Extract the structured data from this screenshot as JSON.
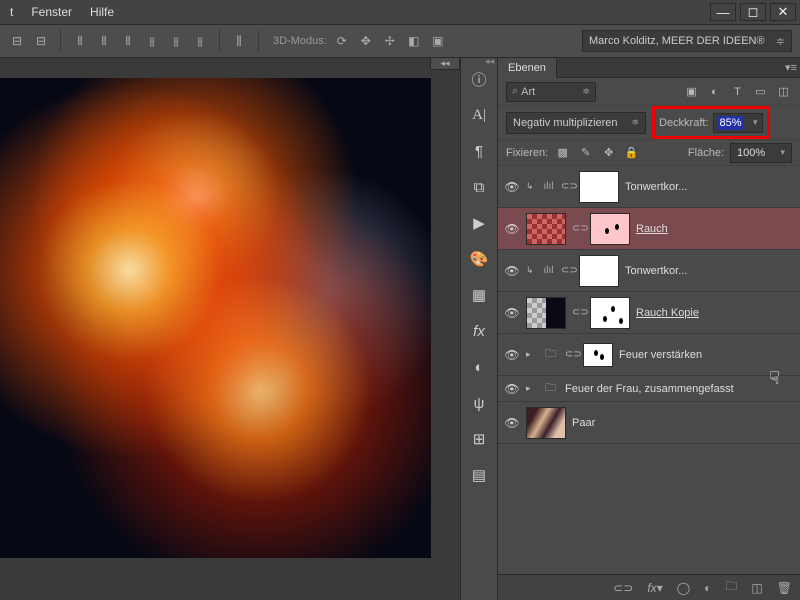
{
  "menubar": {
    "item1": "t",
    "item2": "Fenster",
    "item3": "Hilfe"
  },
  "optbar": {
    "mode_label": "3D-Modus:"
  },
  "credit": {
    "text": "Marco Kolditz, MEER DER IDEEN®"
  },
  "panel": {
    "tab": "Ebenen",
    "filter": "Art",
    "blend_mode": "Negativ multiplizieren",
    "opacity_label": "Deckkraft:",
    "opacity_value": "85%",
    "lock_label": "Fixieren:",
    "fill_label": "Fläche:",
    "fill_value": "100%"
  },
  "layers": [
    {
      "name": "Tonwertkor..."
    },
    {
      "name": "Rauch"
    },
    {
      "name": "Tonwertkor..."
    },
    {
      "name": "Rauch Kopie"
    },
    {
      "name": "Feuer verstärken"
    },
    {
      "name": "Feuer der Frau, zusammengefasst"
    },
    {
      "name": "Paar"
    }
  ]
}
